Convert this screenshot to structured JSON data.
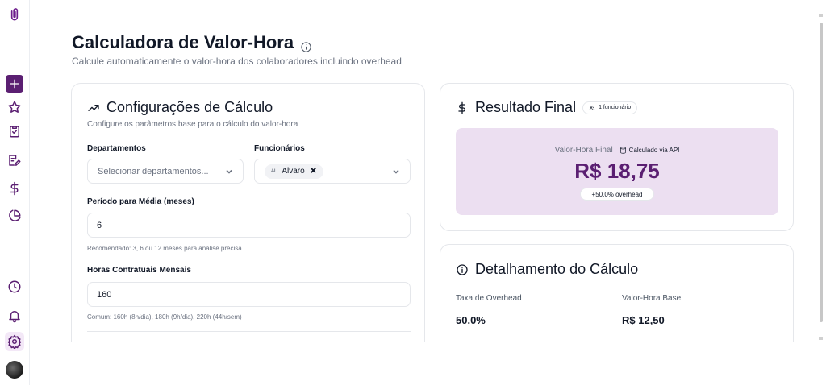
{
  "sidebar": {
    "items": [
      {
        "name": "logo",
        "icon": "paperclip-icon"
      },
      {
        "name": "new",
        "icon": "plus-icon"
      },
      {
        "name": "favorites",
        "icon": "star-icon"
      },
      {
        "name": "tasks",
        "icon": "clipboard-check-icon"
      },
      {
        "name": "edit",
        "icon": "edit-note-icon"
      },
      {
        "name": "finance",
        "icon": "dollar-icon"
      },
      {
        "name": "reports",
        "icon": "pie-chart-icon"
      },
      {
        "name": "history",
        "icon": "clock-icon"
      },
      {
        "name": "notifications",
        "icon": "bell-icon"
      },
      {
        "name": "settings",
        "icon": "gear-icon"
      },
      {
        "name": "profile",
        "icon": "avatar"
      }
    ],
    "accent": "#5b1f72"
  },
  "header": {
    "title": "Calculadora de Valor-Hora",
    "subtitle": "Calcule automaticamente o valor-hora dos colaboradores incluindo overhead"
  },
  "config": {
    "title": "Configurações de Cálculo",
    "description": "Configure os parâmetros base para o cálculo do valor-hora",
    "departments_label": "Departamentos",
    "departments_placeholder": "Selecionar departamentos...",
    "employees_label": "Funcionários",
    "employee_chip_abbr": "AL",
    "employee_chip_name": "Alvaro",
    "period_label": "Período para Média (meses)",
    "period_value": "6",
    "period_hint": "Recomendado: 3, 6 ou 12 meses para análise precisa",
    "hours_label": "Horas Contratuais Mensais",
    "hours_value": "160",
    "hours_hint": "Comum: 160h (8h/dia), 180h (9h/dia), 220h (44h/sem)"
  },
  "result": {
    "title": "Resultado Final",
    "count_badge": "1 funcionário",
    "label": "Valor-Hora Final",
    "api_label": "Calculado via API",
    "value": "R$ 18,75",
    "overhead_badge": "+50.0% overhead",
    "box_color": "#ecdff1",
    "value_color": "#5b1f72"
  },
  "detail": {
    "title": "Detalhamento do Cálculo",
    "overhead_label": "Taxa de Overhead",
    "overhead_value": "50.0%",
    "base_label": "Valor-Hora Base",
    "base_value": "R$ 12,50"
  }
}
